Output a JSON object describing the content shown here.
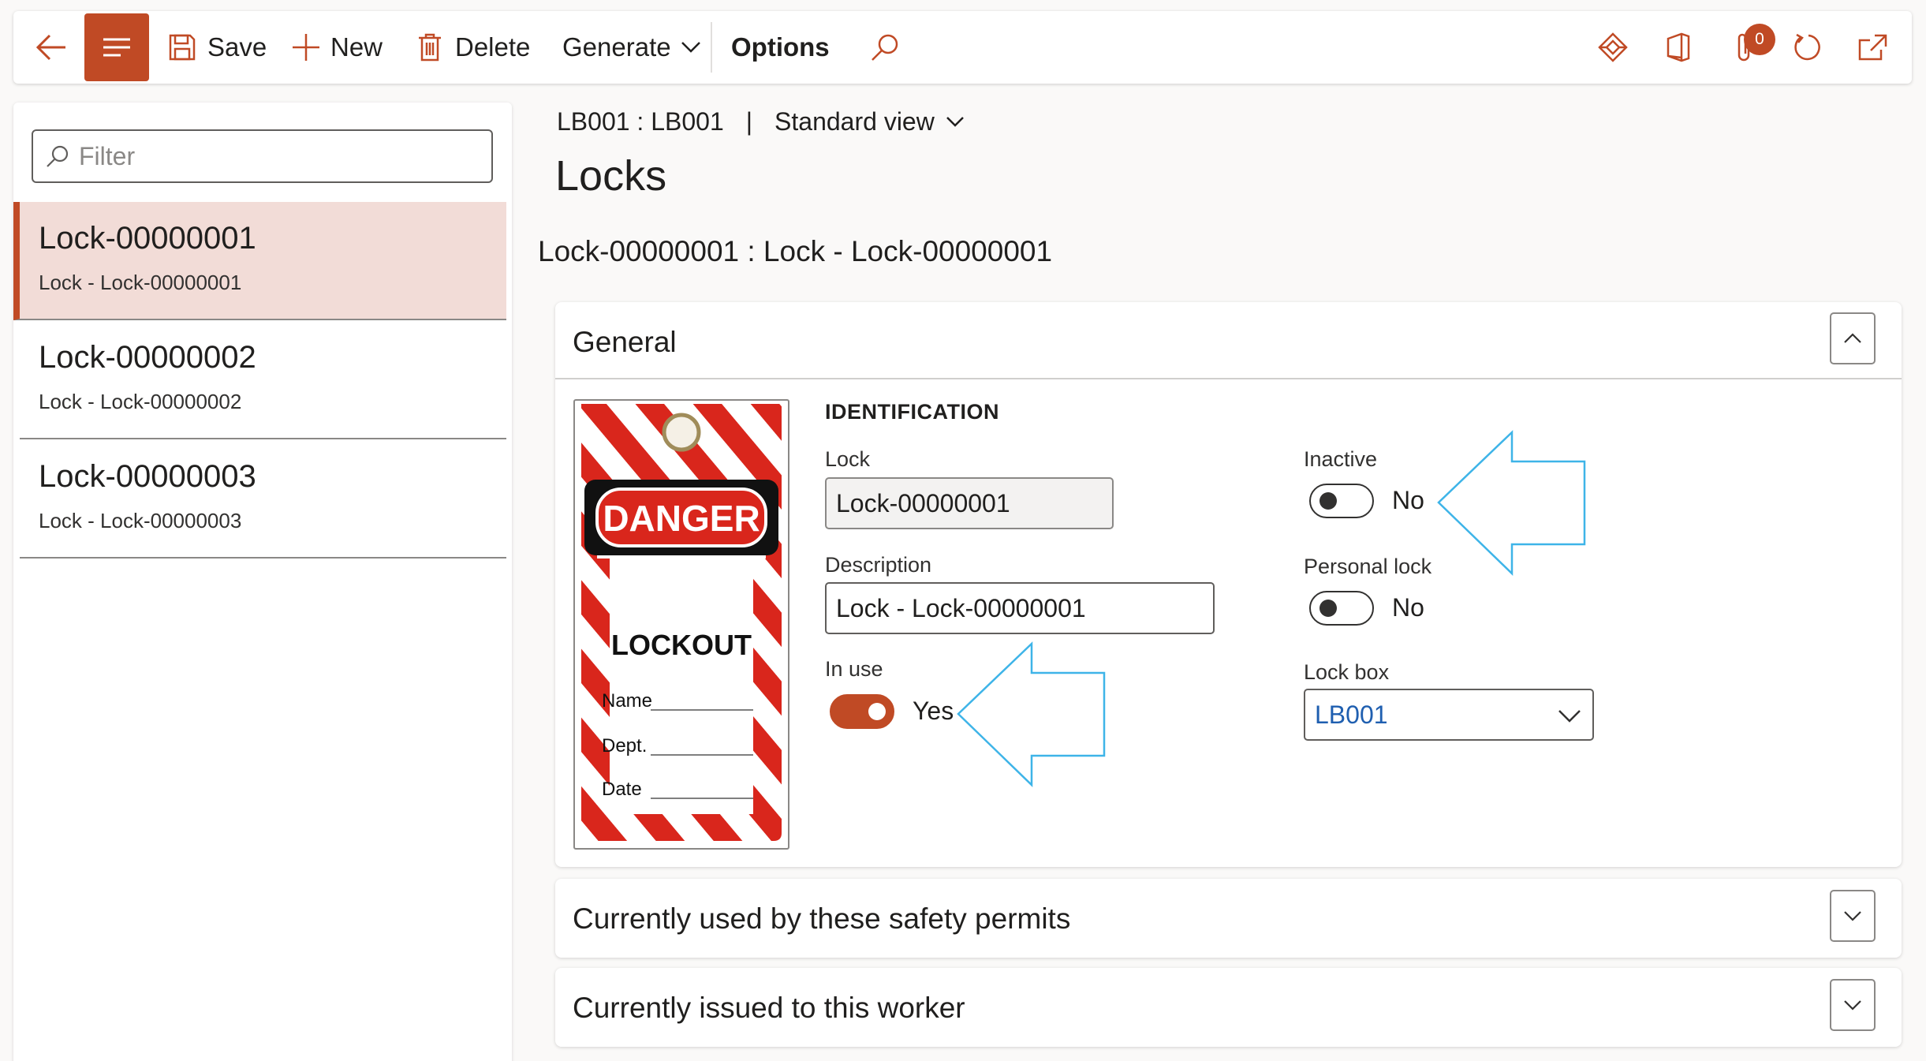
{
  "toolbar": {
    "save_label": "Save",
    "new_label": "New",
    "delete_label": "Delete",
    "generate_label": "Generate",
    "options_label": "Options",
    "notification_count": "0"
  },
  "filter": {
    "placeholder": "Filter"
  },
  "list": [
    {
      "title": "Lock-00000001",
      "subtitle": "Lock - Lock-00000001",
      "selected": true
    },
    {
      "title": "Lock-00000002",
      "subtitle": "Lock - Lock-00000002",
      "selected": false
    },
    {
      "title": "Lock-00000003",
      "subtitle": "Lock - Lock-00000003",
      "selected": false
    }
  ],
  "breadcrumb": {
    "record": "LB001 : LB001",
    "separator": "|",
    "view": "Standard view"
  },
  "page_title": "Locks",
  "record_title": "Lock-00000001 : Lock - Lock-00000001",
  "general": {
    "header": "General",
    "section_title": "IDENTIFICATION",
    "lock_label": "Lock",
    "lock_value": "Lock-00000001",
    "description_label": "Description",
    "description_value": "Lock - Lock-00000001",
    "in_use_label": "In use",
    "in_use_value": "Yes",
    "inactive_label": "Inactive",
    "inactive_value": "No",
    "personal_lock_label": "Personal lock",
    "personal_lock_value": "No",
    "lock_box_label": "Lock box",
    "lock_box_value": "LB001"
  },
  "tag_image": {
    "danger": "DANGER",
    "lockout": "LOCKOUT",
    "name": "Name",
    "dept": "Dept.",
    "date": "Date"
  },
  "sections": {
    "safety_permits": "Currently used by these safety permits",
    "issued_worker": "Currently issued to this worker"
  },
  "colors": {
    "accent": "#c04a25",
    "annotation_arrow": "#3eb4e8",
    "link": "#1f5fb0"
  }
}
